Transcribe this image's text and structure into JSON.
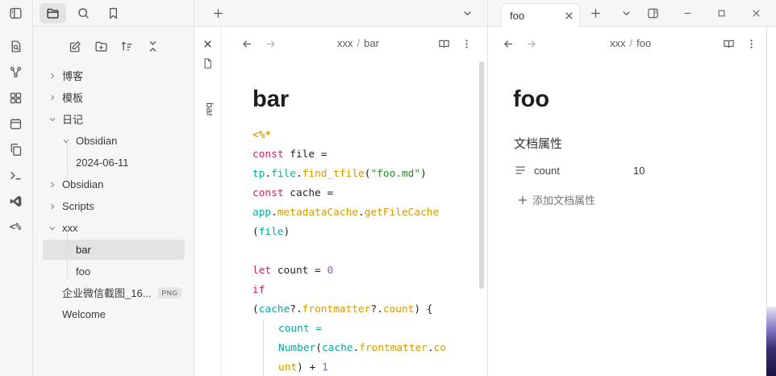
{
  "ribbon": {
    "icons": [
      "open-quick-switcher-icon",
      "graph-view-icon",
      "canvas-icon",
      "daily-note-icon",
      "copy-icon",
      "terminal-icon",
      "vscode-icon",
      "templater-icon"
    ],
    "templater_label": "<%"
  },
  "sidebar": {
    "tabs": [
      "files-icon",
      "search-icon",
      "bookmark-icon"
    ],
    "actions": [
      "new-note-icon",
      "new-folder-icon",
      "sort-icon",
      "collapse-all-icon"
    ],
    "tree": [
      {
        "label": "博客",
        "type": "folder",
        "expanded": false
      },
      {
        "label": "模板",
        "type": "folder",
        "expanded": false
      },
      {
        "label": "日记",
        "type": "folder",
        "expanded": true
      },
      {
        "label": "Obsidian",
        "type": "folder",
        "expanded": true
      },
      {
        "label": "2024-06-11",
        "type": "file"
      },
      {
        "label": "Obsidian",
        "type": "folder",
        "expanded": false
      },
      {
        "label": "Scripts",
        "type": "folder",
        "expanded": false
      },
      {
        "label": "xxx",
        "type": "folder",
        "expanded": true
      },
      {
        "label": "bar",
        "type": "file",
        "selected": true
      },
      {
        "label": "foo",
        "type": "file"
      },
      {
        "label": "企业微信截图_16...",
        "type": "file",
        "badge": "PNG"
      },
      {
        "label": "Welcome",
        "type": "file"
      }
    ]
  },
  "tabs": {
    "right_tab_label": "foo"
  },
  "left_pane": {
    "collapsed_label": "bar",
    "breadcrumb": [
      "xxx",
      "bar"
    ],
    "title": "bar",
    "code": [
      [
        {
          "t": "<%*",
          "c": "tpl"
        }
      ],
      [
        {
          "t": "const ",
          "c": "kw"
        },
        {
          "t": "file =",
          "c": ""
        }
      ],
      [
        {
          "t": "tp",
          "c": "prop"
        },
        {
          "t": ".",
          "c": ""
        },
        {
          "t": "file",
          "c": "prop"
        },
        {
          "t": ".",
          "c": ""
        },
        {
          "t": "find_tfile",
          "c": "fn"
        },
        {
          "t": "(",
          "c": ""
        },
        {
          "t": "\"foo.md\"",
          "c": "str"
        },
        {
          "t": ")",
          "c": ""
        }
      ],
      [
        {
          "t": "const ",
          "c": "kw"
        },
        {
          "t": "cache =",
          "c": ""
        }
      ],
      [
        {
          "t": "app",
          "c": "prop"
        },
        {
          "t": ".",
          "c": ""
        },
        {
          "t": "metadataCache",
          "c": "fn"
        },
        {
          "t": ".",
          "c": ""
        },
        {
          "t": "getFileCache",
          "c": "fn"
        }
      ],
      [
        {
          "t": "(",
          "c": ""
        },
        {
          "t": "file",
          "c": "prop"
        },
        {
          "t": ")",
          "c": ""
        }
      ],
      [],
      [
        {
          "t": "let ",
          "c": "kw"
        },
        {
          "t": "count = ",
          "c": ""
        },
        {
          "t": "0",
          "c": "num"
        }
      ],
      [
        {
          "t": "if",
          "c": "kw"
        }
      ],
      [
        {
          "t": "(",
          "c": ""
        },
        {
          "t": "cache",
          "c": "prop"
        },
        {
          "t": "?.",
          "c": ""
        },
        {
          "t": "frontmatter",
          "c": "fn"
        },
        {
          "t": "?.",
          "c": ""
        },
        {
          "t": "count",
          "c": "fn"
        },
        {
          "t": ") {",
          "c": ""
        }
      ],
      [
        {
          "t": "count =",
          "c": "prop",
          "indent": true
        }
      ],
      [
        {
          "t": "Number",
          "c": "prop",
          "indent": true
        },
        {
          "t": "(",
          "c": ""
        },
        {
          "t": "cache",
          "c": "prop"
        },
        {
          "t": ".",
          "c": ""
        },
        {
          "t": "frontmatter",
          "c": "fn"
        },
        {
          "t": ".",
          "c": ""
        },
        {
          "t": "co",
          "c": "fn"
        }
      ],
      [
        {
          "t": "unt",
          "c": "fn",
          "indent": true
        },
        {
          "t": ") + ",
          "c": ""
        },
        {
          "t": "1",
          "c": "num"
        }
      ]
    ]
  },
  "right_pane": {
    "breadcrumb": [
      "xxx",
      "foo"
    ],
    "title": "foo",
    "properties_title": "文档属性",
    "property": {
      "key": "count",
      "value": "10"
    },
    "add_property_label": "添加文档属性"
  }
}
